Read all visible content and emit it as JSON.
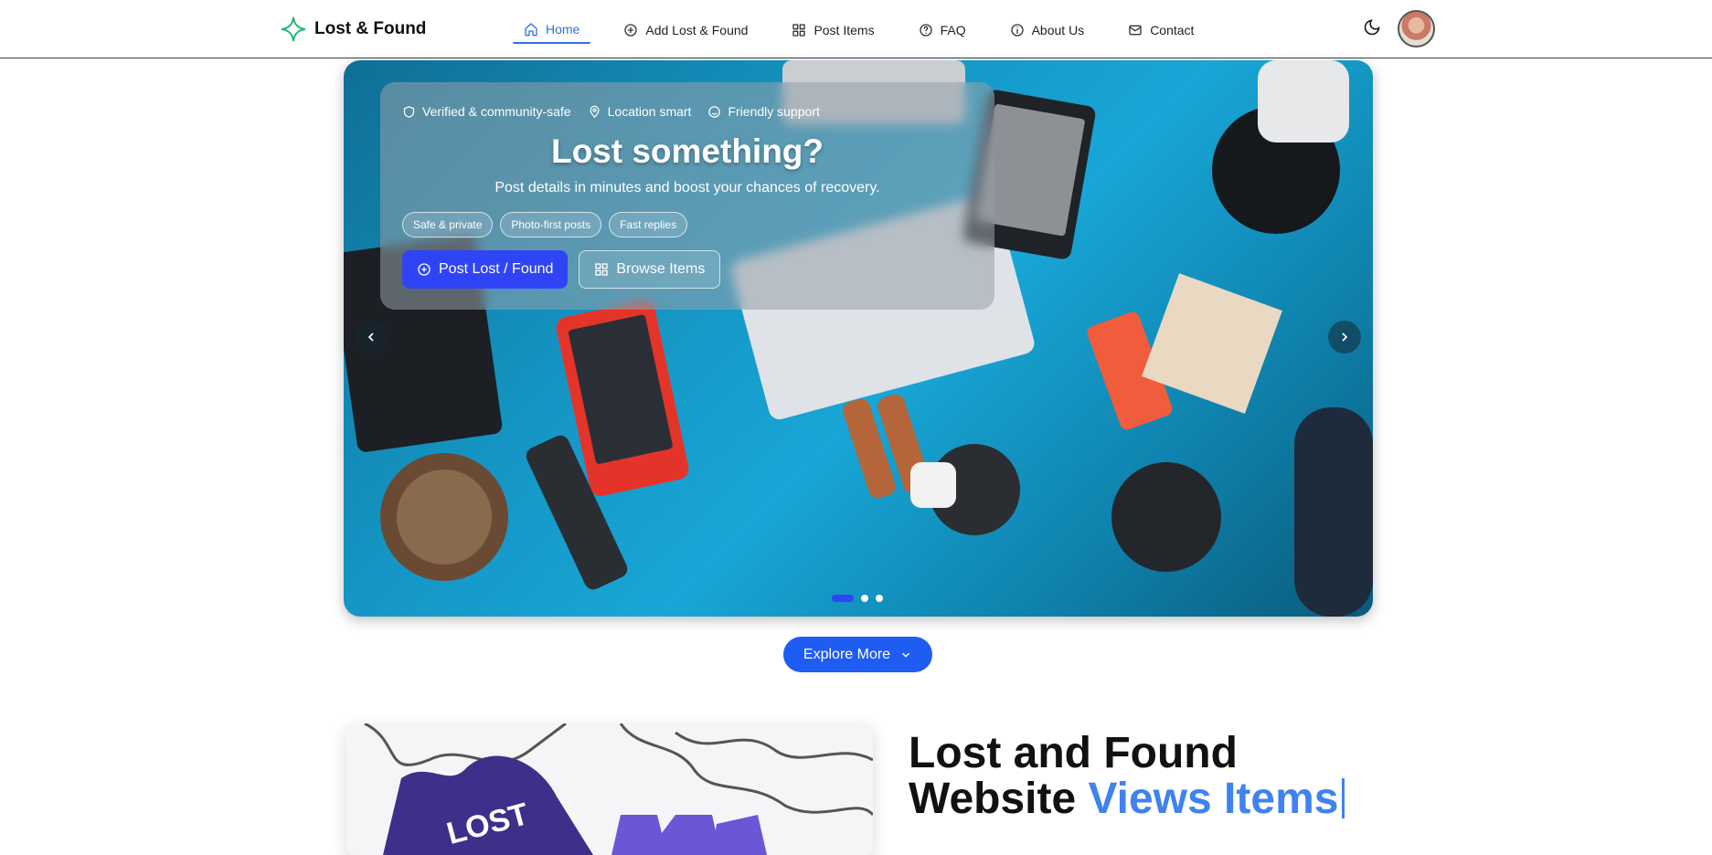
{
  "brand": {
    "name": "Lost & Found",
    "icon": "sparkle-plus-icon",
    "accent": "#22b573"
  },
  "nav": {
    "items": [
      {
        "label": "Home",
        "icon": "home-icon",
        "active": true
      },
      {
        "label": "Add Lost & Found",
        "icon": "plus-circle-icon",
        "active": false
      },
      {
        "label": "Post Items",
        "icon": "grid-icon",
        "active": false
      },
      {
        "label": "FAQ",
        "icon": "help-circle-icon",
        "active": false
      },
      {
        "label": "About Us",
        "icon": "info-icon",
        "active": false
      },
      {
        "label": "Contact",
        "icon": "mail-icon",
        "active": false
      }
    ],
    "theme_toggle_icon": "moon-icon",
    "avatar_icon": "user-avatar"
  },
  "hero": {
    "features": [
      {
        "label": "Verified & community-safe",
        "icon": "shield-icon"
      },
      {
        "label": "Location smart",
        "icon": "map-pin-icon"
      },
      {
        "label": "Friendly support",
        "icon": "smile-icon"
      }
    ],
    "title": "Lost something?",
    "subtitle": "Post details in minutes and boost your chances of recovery.",
    "chips": [
      "Safe & private",
      "Photo-first posts",
      "Fast replies"
    ],
    "primary_button": "Post Lost / Found",
    "secondary_button": "Browse Items",
    "slides_total": 3,
    "active_slide": 1
  },
  "explore": {
    "label": "Explore More",
    "icon": "chevron-down-icon"
  },
  "about": {
    "title_line1": "Lost and Found",
    "title_line2_prefix": "Website ",
    "title_line2_accent": "Views Items",
    "puzzle_label": "LOST"
  },
  "colors": {
    "primary": "#2f45f5",
    "link_active": "#2f6fe4",
    "accent_text": "#3f82f0"
  }
}
